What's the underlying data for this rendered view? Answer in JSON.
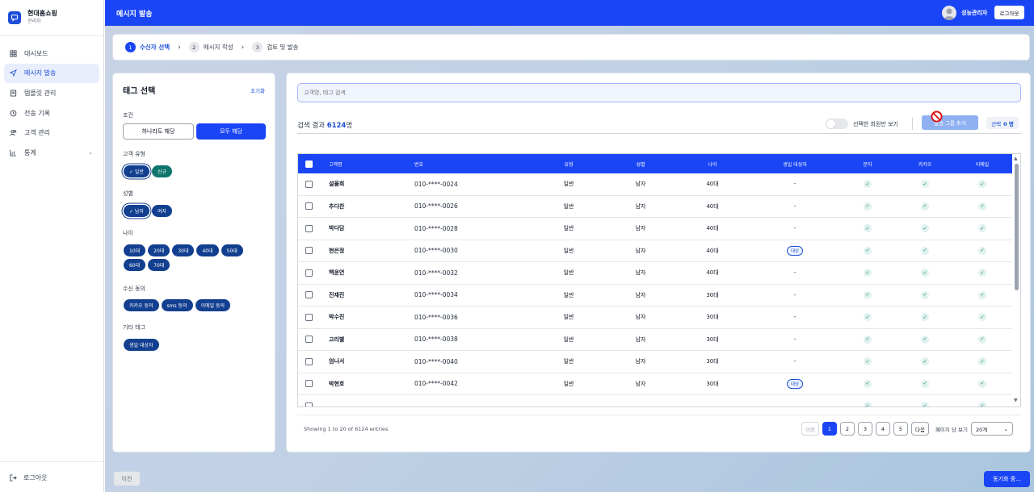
{
  "brand": {
    "name": "현대홈쇼핑",
    "role": "관리자",
    "icon": "chat-icon"
  },
  "nav": [
    {
      "label": "대시보드",
      "icon": "dashboard-icon"
    },
    {
      "label": "메시지 발송",
      "icon": "send-icon",
      "active": true
    },
    {
      "label": "템플릿 관리",
      "icon": "template-icon"
    },
    {
      "label": "전송 기록",
      "icon": "history-icon"
    },
    {
      "label": "고객 관리",
      "icon": "users-icon"
    },
    {
      "label": "통계",
      "icon": "chart-icon",
      "chevron": "⌄"
    }
  ],
  "sidebar_logout": "로그아웃",
  "header": {
    "title": "메시지 발송",
    "user": "성능관리자",
    "logout": "로그아웃"
  },
  "steps": [
    {
      "num": "1",
      "label": "수신자 선택",
      "active": true
    },
    {
      "num": "2",
      "label": "메시지 작성"
    },
    {
      "num": "3",
      "label": "검토 및 발송"
    }
  ],
  "tags": {
    "title": "태그 선택",
    "reset": "초기화",
    "condition_label": "조건",
    "condition_any": "하나라도 해당",
    "condition_all": "모두 해당",
    "customer_type_label": "고객 유형",
    "customer_types": [
      {
        "label": "✓ 일반",
        "selected": true
      },
      {
        "label": "신규",
        "green": true
      }
    ],
    "gender_label": "성별",
    "genders": [
      {
        "label": "✓ 남자",
        "selected": true
      },
      {
        "label": "여자"
      }
    ],
    "age_label": "나이",
    "ages": [
      "10대",
      "20대",
      "30대",
      "40대",
      "50대",
      "60대",
      "70대"
    ],
    "consent_label": "수신 동의",
    "consents": [
      "카카오 동의",
      "sms 동의",
      "이메일 동의"
    ],
    "other_label": "기타 태그",
    "others": [
      "생일 대상자"
    ]
  },
  "main": {
    "search_placeholder": "고객명, 태그 검색",
    "result_prefix": "검색 결과",
    "result_count": "6124",
    "result_suffix": "명",
    "toggle_label": "선택한 회원만 보기",
    "add_button": "발송 그룹 추가",
    "selected_label": "선택",
    "selected_count": "0 명"
  },
  "table": {
    "headers": [
      "고객명",
      "번호",
      "유형",
      "성별",
      "나이",
      "생일 대상자",
      "문자",
      "카카오",
      "이메일"
    ],
    "rows": [
      [
        "설율희",
        "010-****-0024",
        "일반",
        "남자",
        "40대",
        "-"
      ],
      [
        "추다찬",
        "010-****-0026",
        "일반",
        "남자",
        "40대",
        "-"
      ],
      [
        "박다담",
        "010-****-0028",
        "일반",
        "남자",
        "40대",
        "-"
      ],
      [
        "현은정",
        "010-****-0030",
        "일반",
        "남자",
        "40대",
        "대상"
      ],
      [
        "백윤연",
        "010-****-0032",
        "일반",
        "남자",
        "40대",
        "-"
      ],
      [
        "진재진",
        "010-****-0034",
        "일반",
        "남자",
        "30대",
        "-"
      ],
      [
        "박수진",
        "010-****-0036",
        "일반",
        "남자",
        "30대",
        "-"
      ],
      [
        "고리별",
        "010-****-0038",
        "일반",
        "남자",
        "30대",
        "-"
      ],
      [
        "엄나서",
        "010-****-0040",
        "일반",
        "남자",
        "30대",
        "-"
      ],
      [
        "박현호",
        "010-****-0042",
        "일반",
        "남자",
        "30대",
        "대상"
      ],
      [
        "",
        "",
        "",
        "",
        "",
        ""
      ]
    ],
    "check_glyph": "✓"
  },
  "footer": {
    "entries": "Showing 1 to 20 of 6124 entries",
    "prev": "이전",
    "pages": [
      "1",
      "2",
      "3",
      "4",
      "5"
    ],
    "next": "다음",
    "per_page_label": "페이지 당 보기",
    "per_page_value": "20개"
  },
  "bottom": {
    "prev": "이전",
    "sync": "동기화 중..."
  }
}
